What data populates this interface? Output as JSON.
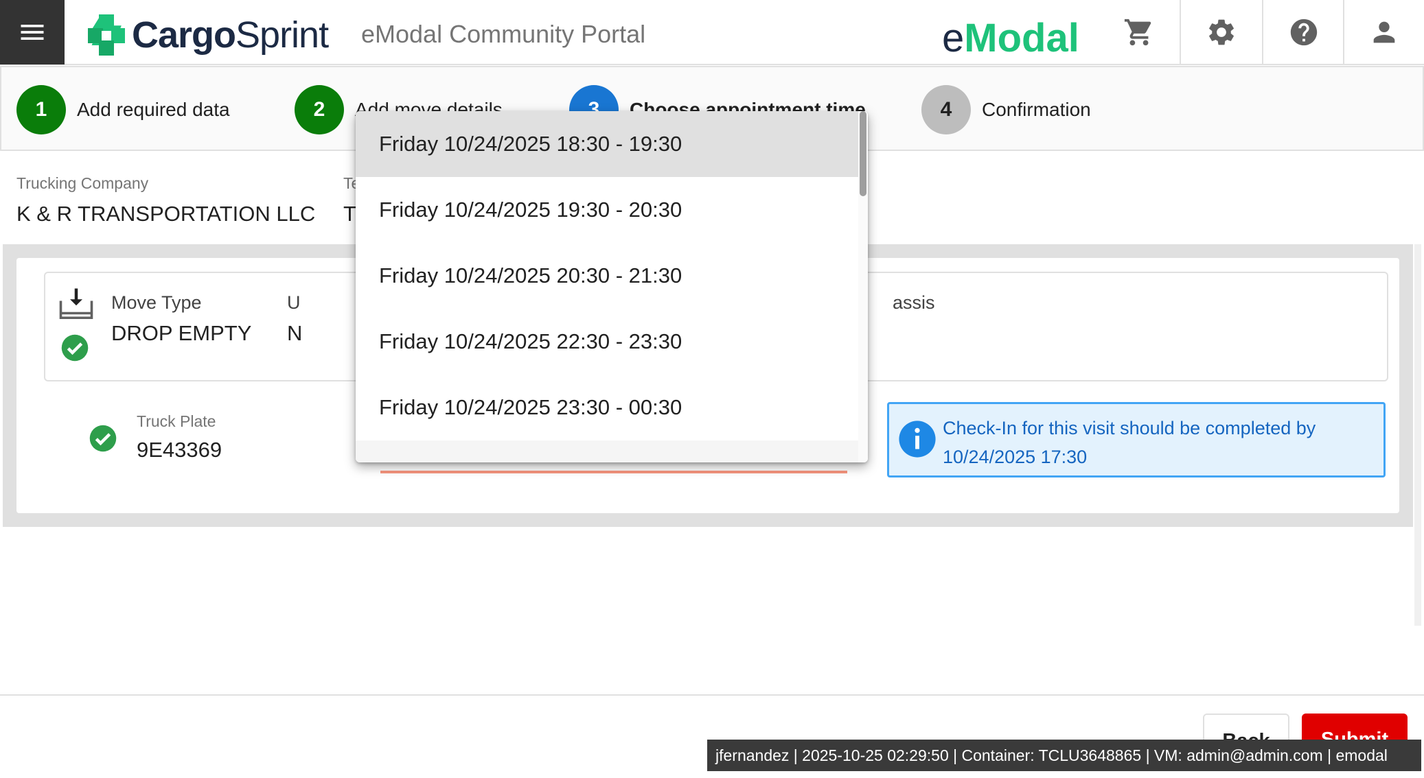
{
  "header": {
    "logo_bold": "Cargo",
    "logo_normal": "Sprint",
    "portal_title": "eModal Community Portal",
    "brand_e": "e",
    "brand_modal": "Modal",
    "icons": [
      "menu-icon",
      "cart-icon",
      "gear-icon",
      "help-icon",
      "user-icon"
    ]
  },
  "stepper": {
    "steps": [
      {
        "number": "1",
        "label": "Add required data",
        "state": "complete",
        "color": "#0a7d0a"
      },
      {
        "number": "2",
        "label": "Add move details",
        "state": "complete",
        "color": "#0a7d0a"
      },
      {
        "number": "3",
        "label": "Choose appointment time",
        "state": "active",
        "color": "#1976d2"
      },
      {
        "number": "4",
        "label": "Confirmation",
        "state": "pending",
        "color": "#bdbdbd"
      }
    ]
  },
  "info": {
    "trucking_label": "Trucking Company",
    "trucking_value": "K & R TRANSPORTATION LLC",
    "partial_label": "Te",
    "partial_value": "T"
  },
  "move": {
    "type_label": "Move Type",
    "type_value": "DROP EMPTY",
    "partial_label_u": "U",
    "partial_value_n": "N",
    "partial_chassis": "assis"
  },
  "truck": {
    "plate_label": "Truck Plate",
    "plate_value": "9E43369"
  },
  "checkin_notice": {
    "text_line1": "Check-In for this visit should be completed by",
    "text_line2": "10/24/2025 17:30"
  },
  "dropdown": {
    "options": [
      "Friday 10/24/2025 18:30 - 19:30",
      "Friday 10/24/2025 19:30 - 20:30",
      "Friday 10/24/2025 20:30 - 21:30",
      "Friday 10/24/2025 22:30 - 23:30",
      "Friday 10/24/2025 23:30 - 00:30"
    ],
    "highlighted_index": 0
  },
  "footer": {
    "back_label": "Back",
    "submit_label": "Submit",
    "status_text": "jfernandez | 2025-10-25 02:29:50 | Container: TCLU3648865 | VM: admin@admin.com | emodal"
  },
  "colors": {
    "success": "#0a7d0a",
    "active": "#1976d2",
    "pending": "#bdbdbd",
    "submit": "#e00000",
    "brand_green": "#1ec27a",
    "info_blue": "#1565c0"
  }
}
